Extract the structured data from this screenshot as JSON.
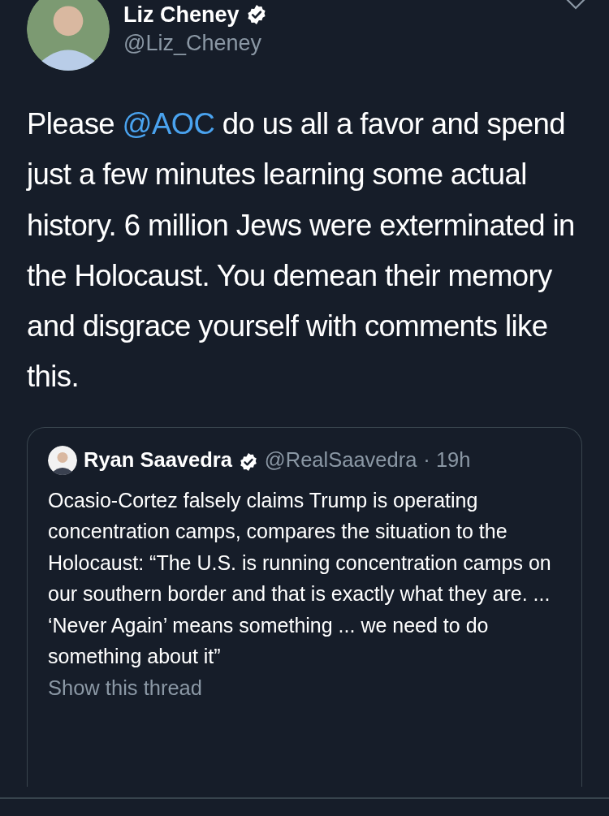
{
  "tweet": {
    "author": {
      "name": "Liz Cheney",
      "verified": true,
      "handle": "@Liz_Cheney"
    },
    "text": [
      {
        "kind": "text",
        "value": "Please "
      },
      {
        "kind": "mention",
        "value": "@AOC"
      },
      {
        "kind": "text",
        "value": " do us all a favor and spend just a few minutes learning some actual history. 6 million Jews were exterminated in the Holocaust. You demean their memory and disgrace yourself with comments like this."
      }
    ],
    "quoted_tweet": {
      "author": {
        "name": "Ryan Saavedra",
        "verified": true,
        "handle": "@RealSaavedra"
      },
      "time": "· 19h",
      "text": "Ocasio-Cortez falsely claims Trump is operating concentration camps, compares the situation to the Holocaust: “The U.S. is running concentration camps on our southern border and that is exactly what they are. ... ‘Never Again’ means something ... we need to do something about it”",
      "thread_link": "Show this thread"
    }
  }
}
